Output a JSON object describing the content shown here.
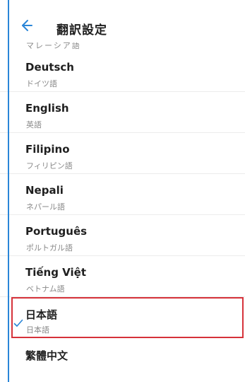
{
  "header": {
    "title": "翻訳設定"
  },
  "clipped_item": {
    "native": "マレーシア語"
  },
  "languages": [
    {
      "name": "Deutsch",
      "native": "ドイツ語"
    },
    {
      "name": "English",
      "native": "英語"
    },
    {
      "name": "Filipino",
      "native": "フィリピン語"
    },
    {
      "name": "Nepali",
      "native": "ネパール語"
    },
    {
      "name": "Português",
      "native": "ポルトガル語"
    },
    {
      "name": "Tiếng Việt",
      "native": "ベトナム語"
    },
    {
      "name": "日本語",
      "native": "日本語",
      "selected": true
    },
    {
      "name": "繁體中文",
      "native": ""
    }
  ],
  "colors": {
    "accent": "#2a86d8",
    "selection_border": "#d6323a"
  },
  "icons": {
    "back": "arrow-left",
    "selected": "check"
  }
}
